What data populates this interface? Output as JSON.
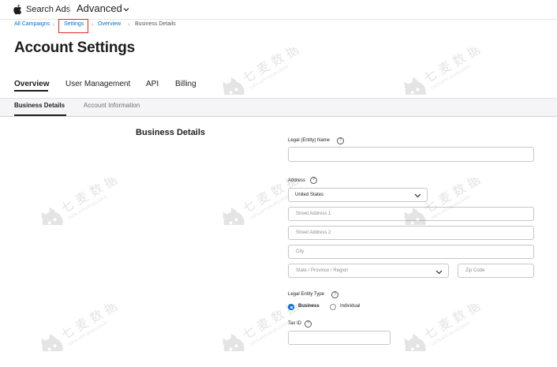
{
  "header": {
    "brand": "Search Ads",
    "product": "Advanced"
  },
  "breadcrumb": [
    "All Campaigns",
    "Settings",
    "Overview",
    "Business Details"
  ],
  "page_title": "Account Settings",
  "tabs": [
    "Overview",
    "User Management",
    "API",
    "Billing"
  ],
  "subtabs": [
    "Business Details",
    "Account Information"
  ],
  "section_title": "Business Details",
  "form": {
    "legal_name_label": "Legal (Entity) Name",
    "legal_name_value": "",
    "address_label": "Address",
    "country_value": "United States",
    "street1_placeholder": "Street Address 1",
    "street2_placeholder": "Street Address 2",
    "city_placeholder": "City",
    "state_placeholder": "State / Province / Region",
    "zip_placeholder": "Zip Code",
    "entity_type_label": "Legal Entity Type",
    "entity_type_options": [
      "Business",
      "Individual"
    ],
    "entity_type_selected": "Business",
    "tax_id_label": "Tax ID",
    "info_glyph": "?"
  },
  "watermark": {
    "text": "七 麦 数 据",
    "subtext": "DATA-APP-DEVELOPER"
  },
  "colors": {
    "link": "#0070c9",
    "accent": "#0071e3",
    "highlight_box": "#e32727"
  }
}
